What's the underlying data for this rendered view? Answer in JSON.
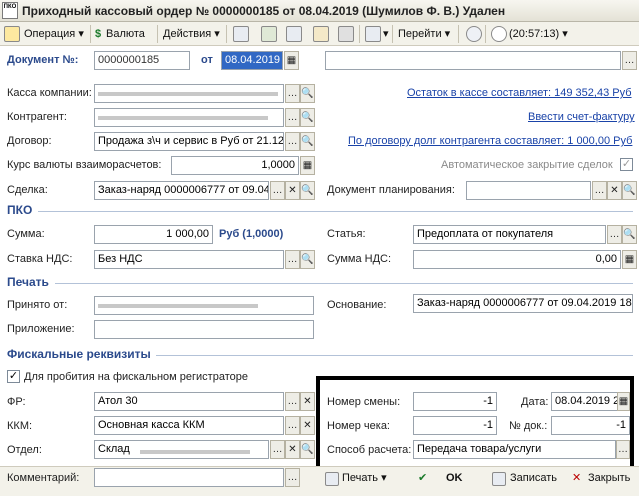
{
  "window": {
    "title": "Приходный кассовый ордер № 0000000185 от 08.04.2019 (Шумилов Ф. В.) Удален",
    "icon_text": "ПКО"
  },
  "toolbar": {
    "operation": "Операция",
    "currency": "Валюта",
    "actions": "Действия",
    "goto": "Перейти",
    "time": "(20:57:13)"
  },
  "doc": {
    "number_label": "Документ №:",
    "number": "0000000185",
    "date_label": "от",
    "date": "08.04.2019"
  },
  "form": {
    "company_label": "Касса компании:",
    "company_value": "Наличный расчет \"КАПИТАЛ\"",
    "counterparty_label": "Контрагент:",
    "counterparty_value": "",
    "contract_label": "Договор:",
    "contract_value": "Продажа з\\ч и сервис в Руб от 21.12",
    "rate_label": "Курс валюты взаиморасчетов:",
    "rate_value": "1,0000",
    "deal_label": "Сделка:",
    "deal_value": "Заказ-наряд 0000006777 от 09.04",
    "planning_label": "Документ планирования:",
    "planning_value": "",
    "cash_balance_link": "Остаток в кассе составляет: 149 352,43 Руб",
    "invoice_link": "Ввести счет-фактуру",
    "debt_link": "По договору долг контрагента составляет: 1 000,00 Руб",
    "auto_close_label": "Автоматическое закрытие сделок"
  },
  "pko": {
    "section": "ПКО",
    "sum_label": "Сумма:",
    "sum_value": "1 000,00",
    "sum_currency": "Руб (1,0000)",
    "vat_rate_label": "Ставка НДС:",
    "vat_rate_value": "Без НДС",
    "article_label": "Статья:",
    "article_value": "Предоплата от покупателя",
    "vat_sum_label": "Сумма НДС:",
    "vat_sum_value": "0,00"
  },
  "print": {
    "section": "Печать",
    "received_label": "Принято от:",
    "received_value": "",
    "basis_label": "Основание:",
    "basis_value": "Заказ-наряд 0000006777 от 09.04.2019 18",
    "attachment_label": "Приложение:",
    "attachment_value": ""
  },
  "fiscal": {
    "section": "Фискальные реквизиты",
    "checkbox_label": "Для пробития на фискальном регистраторе",
    "fr_label": "ФР:",
    "fr_value": "Атол 30",
    "kkm_label": "ККМ:",
    "kkm_value": "Основная касса ККМ",
    "dept_label": "Отдел:",
    "dept_value": "Склад",
    "shift_label": "Номер смены:",
    "shift_value": "-1",
    "date_label": "Дата:",
    "date_value": "08.04.2019 2",
    "check_label": "Номер чека:",
    "check_value": "-1",
    "docnum_label": "№ док.:",
    "docnum_value": "-1",
    "payment_label": "Способ расчета:",
    "payment_value": "Передача товара/услуги"
  },
  "footer": {
    "comment_label": "Комментарий:",
    "print_btn": "Печать",
    "ok_btn": "OK",
    "save_btn": "Записать",
    "close_btn": "Закрыть"
  }
}
